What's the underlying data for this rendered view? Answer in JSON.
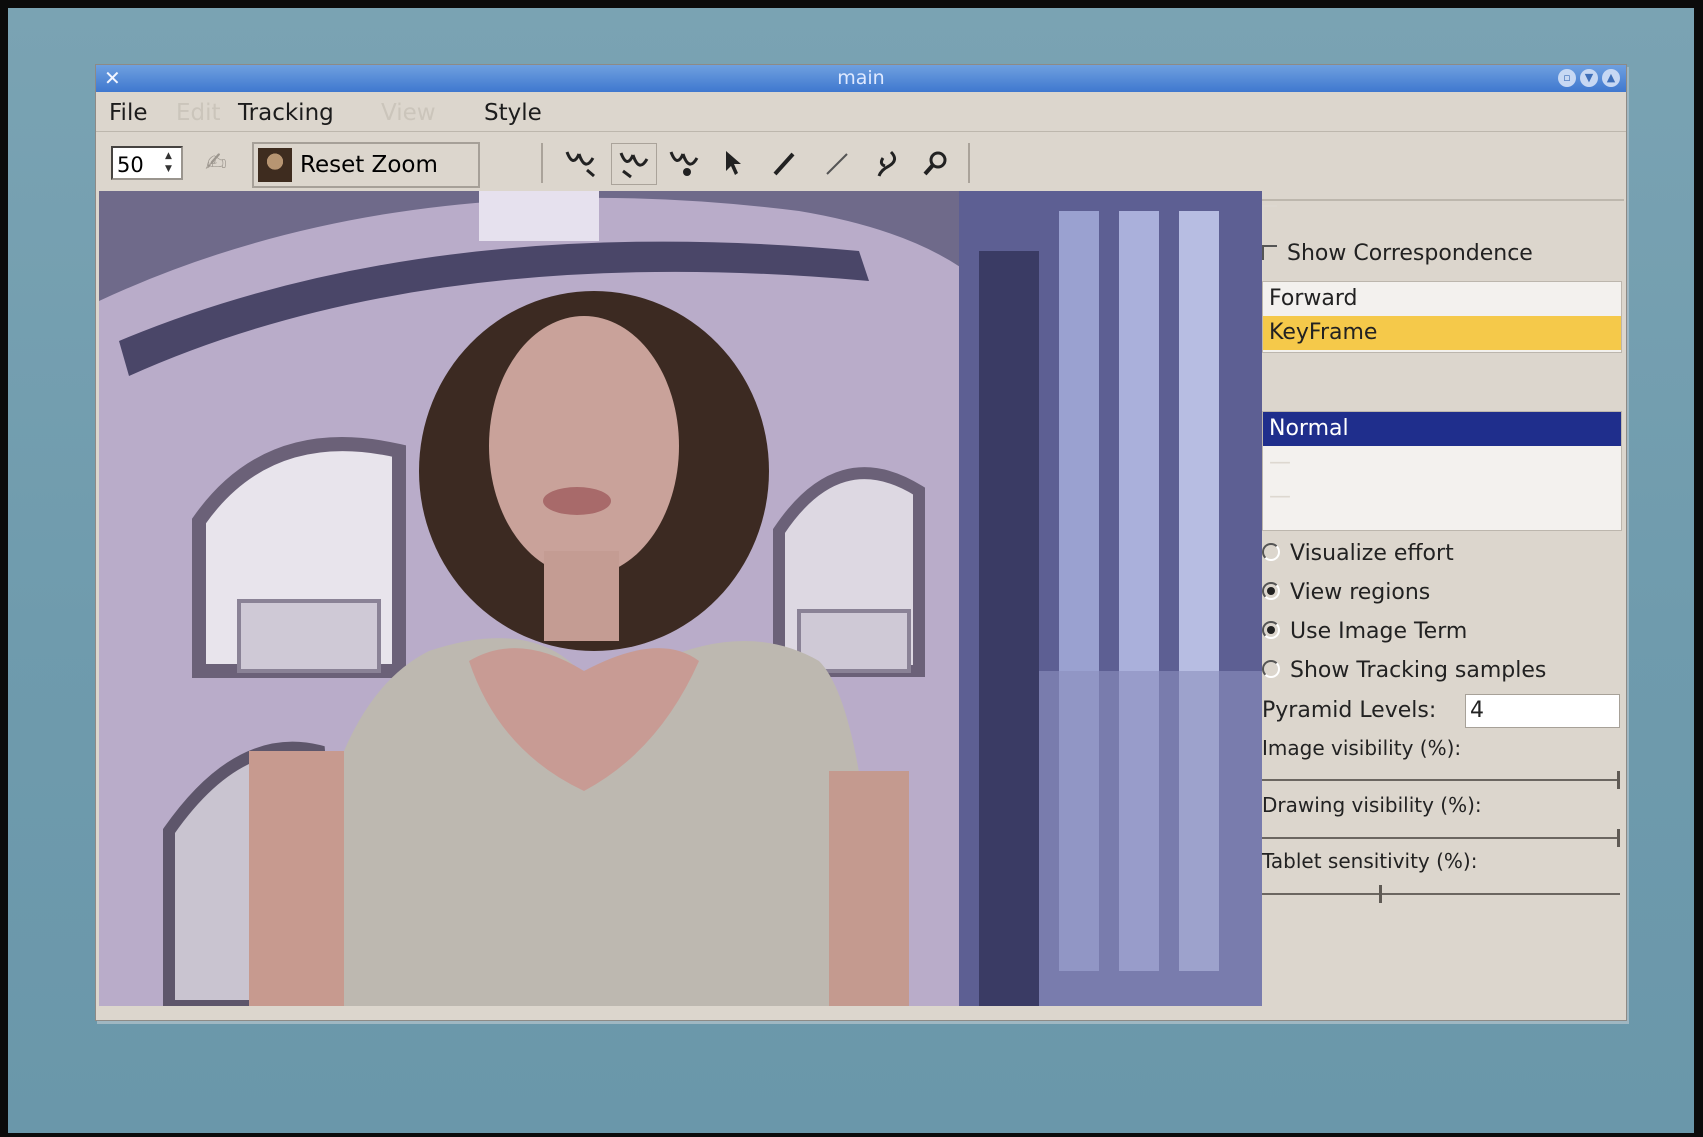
{
  "window": {
    "title": "main"
  },
  "menu": {
    "file": "File",
    "edit": "Edit",
    "tracking": "Tracking",
    "view": "View",
    "style": "Style"
  },
  "toolbar": {
    "zoom_value": "50",
    "reset_zoom_label": "Reset Zoom",
    "icons": [
      "track-forward-icon",
      "track-back-icon",
      "track-both-icon",
      "pointer-icon",
      "pen-icon",
      "line-icon",
      "lasso-icon",
      "magnifier-icon"
    ]
  },
  "panel": {
    "show_correspondence_label": "Show Correspondence",
    "list1": [
      "Forward",
      "KeyFrame"
    ],
    "list2": [
      "Normal"
    ],
    "options": [
      {
        "label": "Visualize effort",
        "checked": false
      },
      {
        "label": "View regions",
        "checked": true
      },
      {
        "label": "Use Image Term",
        "checked": true
      },
      {
        "label": "Show Tracking samples",
        "checked": false
      }
    ],
    "pyramid_label": "Pyramid Levels:",
    "pyramid_value": "4",
    "image_vis_label": "Image visibility (%):",
    "image_vis_level": 1.0,
    "drawing_vis_label": "Drawing visibility (%):",
    "drawing_vis_level": 1.0,
    "tablet_label": "Tablet sensitivity (%):",
    "tablet_level": 0.33
  },
  "colors": {
    "titlebar": "#4a83d6",
    "keyframe_highlight": "#f5c94a",
    "normal_highlight": "#1f2e8c"
  }
}
